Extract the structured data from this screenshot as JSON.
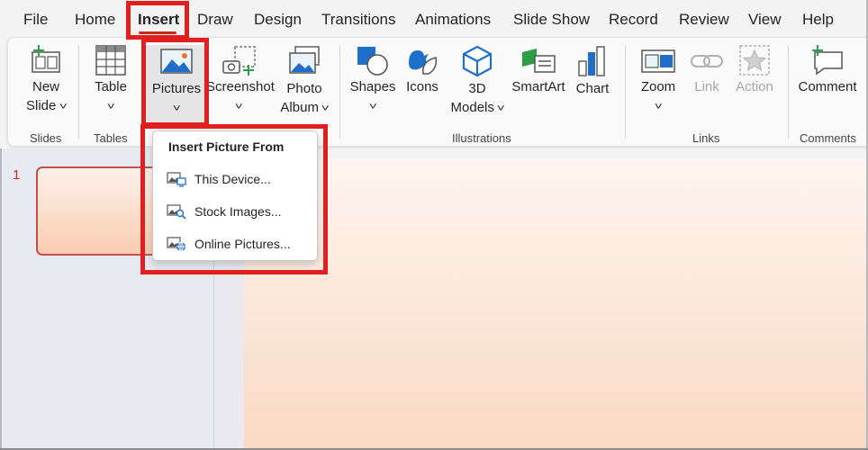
{
  "menu": {
    "tabs": [
      {
        "label": "File"
      },
      {
        "label": "Home"
      },
      {
        "label": "Insert"
      },
      {
        "label": "Draw"
      },
      {
        "label": "Design"
      },
      {
        "label": "Transitions"
      },
      {
        "label": "Animations"
      },
      {
        "label": "Slide Show"
      },
      {
        "label": "Record"
      },
      {
        "label": "Review"
      },
      {
        "label": "View"
      },
      {
        "label": "Help"
      }
    ],
    "active_tab": "Insert"
  },
  "ribbon": {
    "new_slide": {
      "line1": "New",
      "line2": "Slide",
      "icon": "new-slide-icon"
    },
    "table": {
      "label": "Table",
      "icon": "table-icon"
    },
    "pictures": {
      "label": "Pictures",
      "icon": "picture-icon"
    },
    "screenshot": {
      "label": "Screenshot",
      "icon": "screenshot-icon"
    },
    "photo_album": {
      "line1": "Photo",
      "line2": "Album",
      "icon": "photo-album-icon"
    },
    "shapes": {
      "label": "Shapes",
      "icon": "shapes-icon"
    },
    "icons": {
      "label": "Icons",
      "icon": "icons-icon"
    },
    "models_3d": {
      "line1": "3D",
      "line2": "Models",
      "icon": "cube-icon"
    },
    "smartart": {
      "label": "SmartArt",
      "icon": "smartart-icon"
    },
    "chart": {
      "label": "Chart",
      "icon": "chart-icon"
    },
    "zoom": {
      "label": "Zoom",
      "icon": "zoom-icon"
    },
    "link": {
      "label": "Link",
      "icon": "link-icon"
    },
    "action": {
      "label": "Action",
      "icon": "action-star-icon"
    },
    "comment": {
      "label": "Comment",
      "icon": "comment-icon"
    },
    "groups": {
      "slides": "Slides",
      "tables": "Tables",
      "illustrations": "Illustrations",
      "links": "Links",
      "comments": "Comments"
    }
  },
  "dropdown": {
    "title": "Insert Picture From",
    "items": [
      {
        "label": "This Device...",
        "icon": "device-picture-icon"
      },
      {
        "label": "Stock Images...",
        "icon": "stock-images-icon"
      },
      {
        "label": "Online Pictures...",
        "icon": "online-pictures-icon"
      }
    ]
  },
  "slides": {
    "first_number": "1"
  },
  "colors": {
    "accent": "#c42b1c",
    "highlight": "#e02020",
    "slide_top": "#fef5f0",
    "slide_bottom": "#f9d9c3"
  }
}
